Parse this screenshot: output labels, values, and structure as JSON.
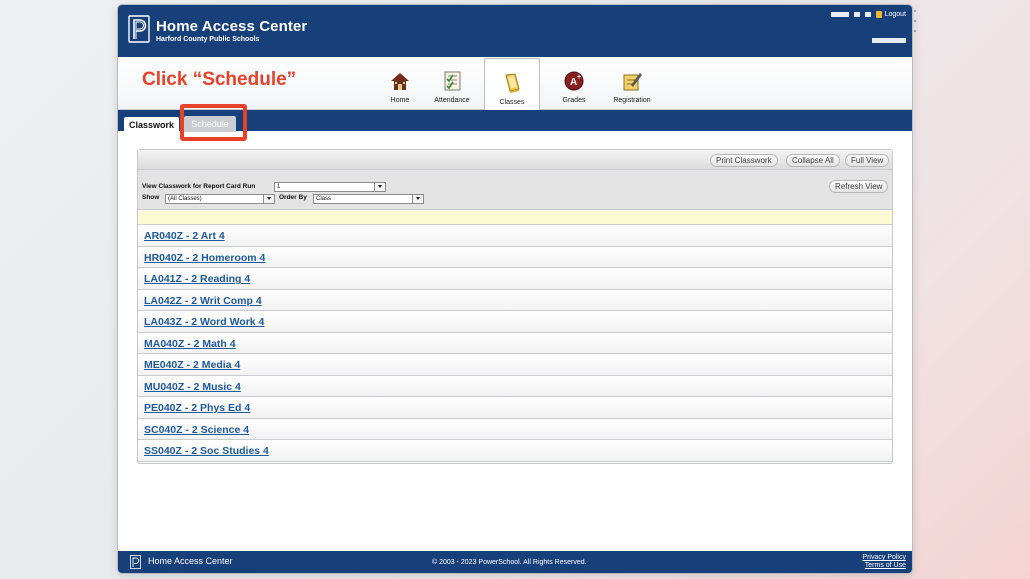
{
  "header": {
    "title": "Home Access Center",
    "subtitle": "Harford County Public Schools",
    "logout_label": "Logout"
  },
  "callout": {
    "text": "Click “Schedule”",
    "color": "#e8412a"
  },
  "nav": {
    "items": [
      {
        "label": "Home",
        "icon": "house-icon"
      },
      {
        "label": "Attendance",
        "icon": "attendance-icon"
      },
      {
        "label": "Classes",
        "icon": "book-icon",
        "active": true
      },
      {
        "label": "Grades",
        "icon": "grades-icon"
      },
      {
        "label": "Registration",
        "icon": "registration-icon"
      }
    ]
  },
  "tabs": {
    "classwork": "Classwork",
    "schedule": "Schedule"
  },
  "toolbar": {
    "print_label": "Print Classwork",
    "collapse_label": "Collapse All",
    "full_view_label": "Full View",
    "refresh_label": "Refresh View"
  },
  "filters": {
    "report_card_run_label": "View Classwork for Report Card Run",
    "report_card_run_value": "1",
    "show_label": "Show",
    "show_value": "(All Classes)",
    "order_by_label": "Order By",
    "order_by_value": "Class"
  },
  "classes": [
    "AR040Z - 2 Art 4",
    "HR040Z - 2 Homeroom 4",
    "LA041Z - 2 Reading 4",
    "LA042Z - 2 Writ Comp 4",
    "LA043Z - 2 Word Work 4",
    "MA040Z - 2 Math 4",
    "ME040Z - 2 Media 4",
    "MU040Z - 2 Music 4",
    "PE040Z - 2 Phys Ed 4",
    "SC040Z - 2 Science 4",
    "SS040Z - 2 Soc Studies 4"
  ],
  "footer": {
    "title": "Home Access Center",
    "copyright": "© 2003 - 2023 PowerSchool. All Rights Reserved.",
    "privacy": "Privacy Policy",
    "terms": "Terms of Use"
  },
  "colors": {
    "brand_navy": "#173f7a",
    "link_blue": "#1f5a9e",
    "highlight_red": "#e8412a"
  }
}
